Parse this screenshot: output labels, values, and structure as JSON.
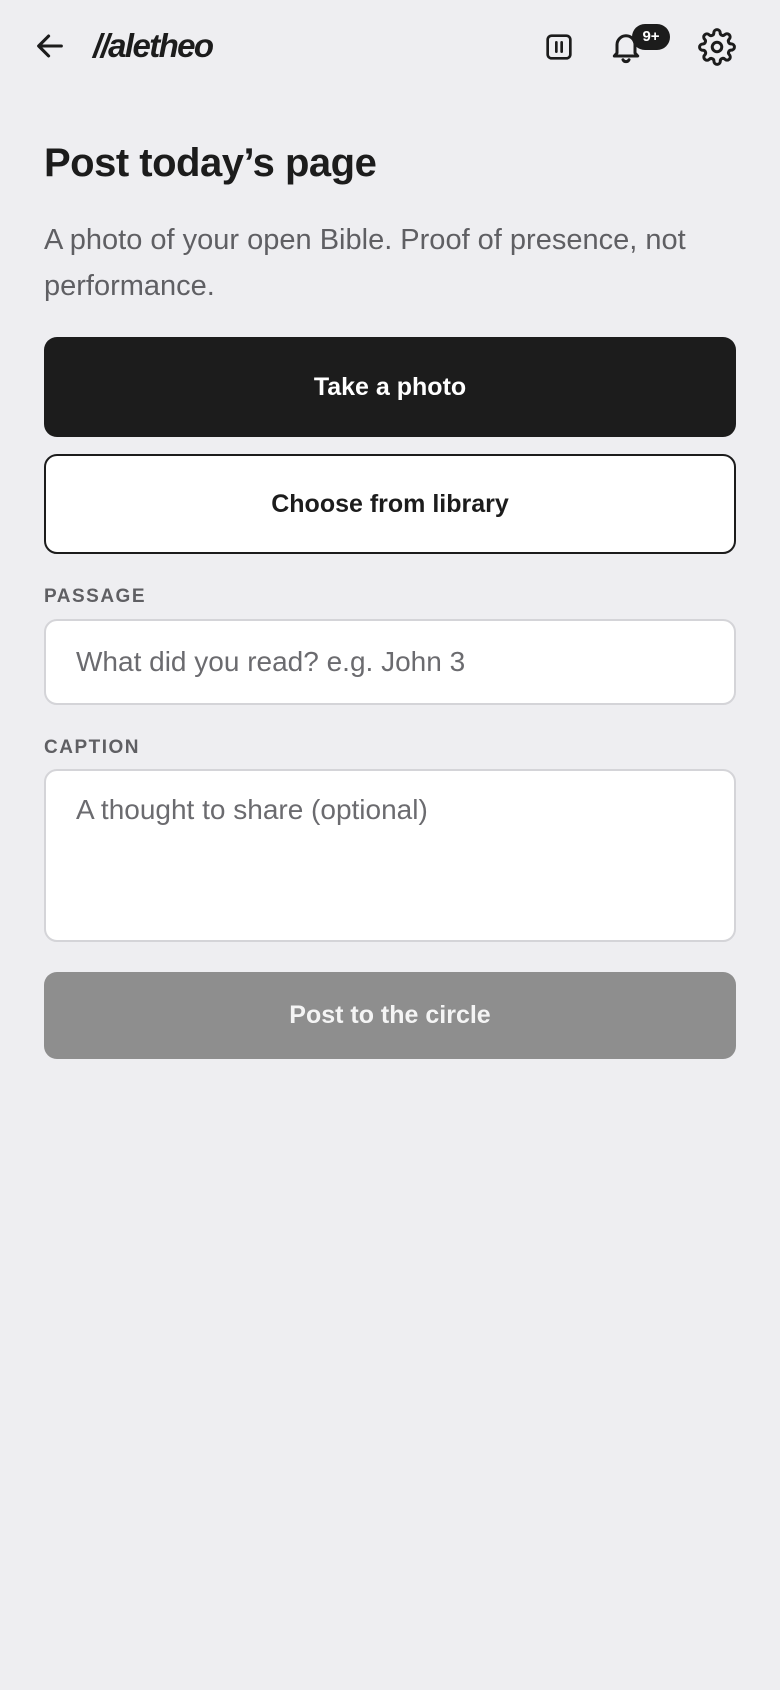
{
  "header": {
    "back_icon": "arrow-left-icon",
    "logo": "//aletheo",
    "pause_icon": "pause-icon",
    "bell_icon": "bell-icon",
    "notification_badge": "9+",
    "settings_icon": "gear-icon"
  },
  "main": {
    "title": "Post today’s page",
    "subtitle": "A photo of your open Bible. Proof of presence, not performance.",
    "take_photo_label": "Take a photo",
    "choose_library_label": "Choose from library",
    "passage": {
      "label": "PASSAGE",
      "placeholder": "What did you read? e.g. John 3",
      "value": ""
    },
    "caption": {
      "label": "CAPTION",
      "placeholder": "A thought to share (optional)",
      "value": ""
    },
    "post_label": "Post to the circle"
  },
  "colors": {
    "background": "#eeeef1",
    "primary": "#1c1c1c",
    "muted_text": "#5f5f63",
    "disabled_button": "#8e8e8e",
    "input_border": "#d4d4d8"
  }
}
